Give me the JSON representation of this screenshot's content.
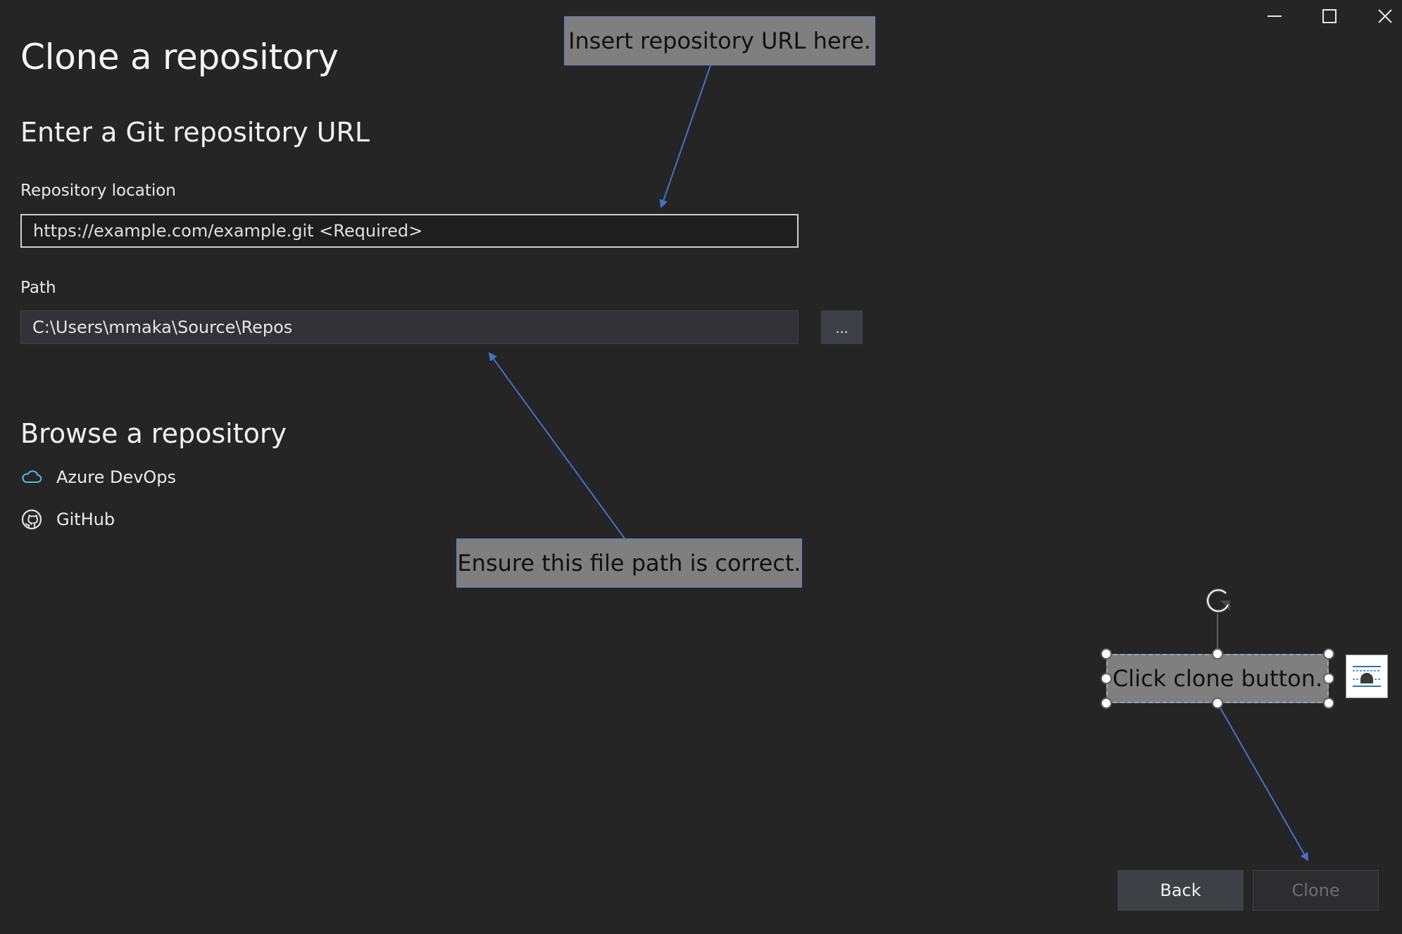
{
  "window": {
    "minimize_icon": "minimize-icon",
    "maximize_icon": "maximize-icon",
    "close_icon": "close-icon"
  },
  "header": {
    "title": "Clone a repository"
  },
  "git_url_section": {
    "title": "Enter a Git repository URL",
    "repository_location": {
      "label": "Repository location",
      "placeholder": "https://example.com/example.git <Required>",
      "value": ""
    },
    "path": {
      "label": "Path",
      "value": "C:\\Users\\mmaka\\Source\\Repos",
      "browse_label": "..."
    }
  },
  "browse_section": {
    "title": "Browse a repository",
    "providers": [
      {
        "label": "Azure DevOps",
        "icon": "cloud-icon"
      },
      {
        "label": "GitHub",
        "icon": "github-icon"
      }
    ]
  },
  "annotations": {
    "url_callout": "Insert repository URL here.",
    "path_callout": "Ensure this file path is correct.",
    "clone_callout": "Click clone button.",
    "rotate_icon": "rotate-icon",
    "layout_options_icon": "layout-options-icon"
  },
  "footer": {
    "back_label": "Back",
    "clone_label": "Clone"
  },
  "colors": {
    "background": "#252526",
    "callout_fill": "#7f7f7f",
    "arrow": "#4472c4",
    "azure_icon": "#5fb4e5"
  }
}
